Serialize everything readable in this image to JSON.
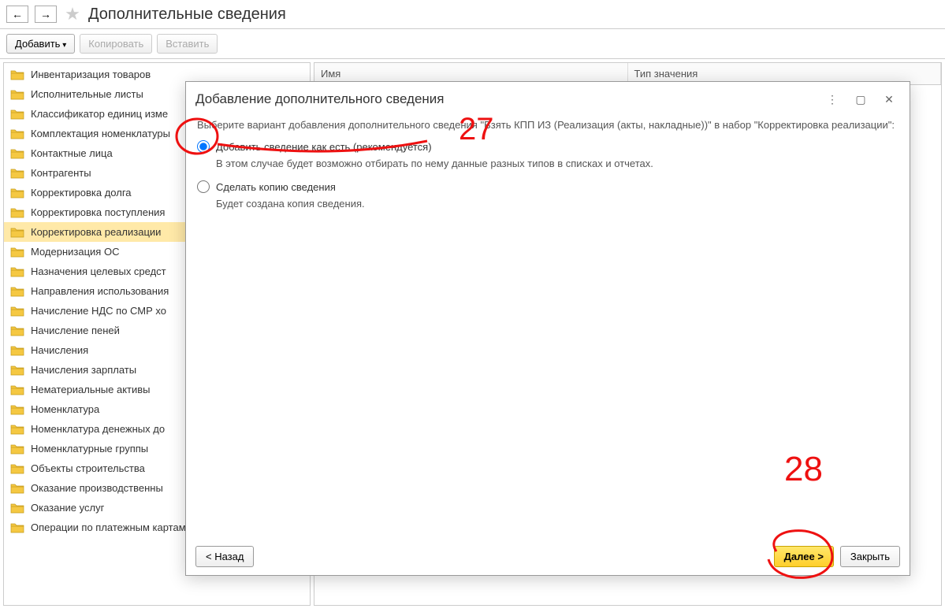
{
  "header": {
    "page_title": "Дополнительные сведения"
  },
  "toolbar": {
    "add_label": "Добавить",
    "copy_label": "Копировать",
    "paste_label": "Вставить"
  },
  "tree": {
    "items": [
      {
        "label": "Инвентаризация товаров"
      },
      {
        "label": "Исполнительные листы"
      },
      {
        "label": "Классификатор единиц изме"
      },
      {
        "label": "Комплектация номенклатуры"
      },
      {
        "label": "Контактные лица"
      },
      {
        "label": "Контрагенты"
      },
      {
        "label": "Корректировка долга"
      },
      {
        "label": "Корректировка поступления"
      },
      {
        "label": "Корректировка реализации",
        "selected": true
      },
      {
        "label": "Модернизация ОС"
      },
      {
        "label": "Назначения целевых средст"
      },
      {
        "label": "Направления использования"
      },
      {
        "label": "Начисление НДС по СМР хо"
      },
      {
        "label": "Начисление пеней"
      },
      {
        "label": "Начисления"
      },
      {
        "label": "Начисления зарплаты"
      },
      {
        "label": "Нематериальные активы"
      },
      {
        "label": "Номенклатура"
      },
      {
        "label": "Номенклатура денежных до"
      },
      {
        "label": "Номенклатурные группы"
      },
      {
        "label": "Объекты строительства"
      },
      {
        "label": "Оказание производственны"
      },
      {
        "label": "Оказание услуг"
      },
      {
        "label": "Операции по платежным картам"
      }
    ]
  },
  "table": {
    "columns": [
      "Имя",
      "Тип значения"
    ]
  },
  "dialog": {
    "title": "Добавление дополнительного сведения",
    "instruction": "Выберите вариант добавления дополнительного сведения \"Взять КПП ИЗ (Реализация (акты, накладные))\" в набор \"Корректировка реализации\":",
    "option1_label": "Добавить сведение как есть (рекомендуется)",
    "option1_desc": "В этом случае будет возможно отбирать по нему данные разных типов в списках и отчетах.",
    "option2_label": "Сделать копию сведения",
    "option2_desc": "Будет создана копия сведения.",
    "back_label": "< Назад",
    "next_label": "Далее >",
    "close_label": "Закрыть"
  },
  "annotations": {
    "a1": "27",
    "a2": "28"
  }
}
